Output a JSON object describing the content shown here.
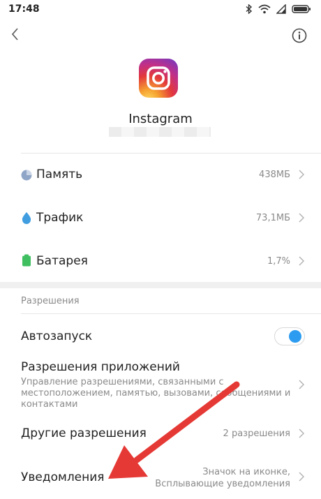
{
  "status_bar": {
    "time": "17:48"
  },
  "app": {
    "name": "Instagram"
  },
  "storage_rows": [
    {
      "label": "Память",
      "value": "438МБ",
      "icon": "pie-chart-icon"
    },
    {
      "label": "Трафик",
      "value": "73,1МБ",
      "icon": "drop-icon"
    },
    {
      "label": "Батарея",
      "value": "1,7%",
      "icon": "battery-icon"
    }
  ],
  "permissions": {
    "section_title": "Разрешения",
    "autostart": {
      "label": "Автозапуск",
      "enabled": true
    },
    "app_permissions": {
      "label": "Разрешения приложений",
      "desc_lines": [
        "Управление разрешениями, связанными с",
        "местоположением, памятью, вызовами, сообщениями и",
        "контактами"
      ]
    },
    "other": {
      "label": "Другие разрешения",
      "value": "2 разрешения"
    },
    "notifications": {
      "label": "Уведомления",
      "value_lines": [
        "Значок на иконке,",
        "Всплывающие уведомления"
      ]
    }
  },
  "colors": {
    "accent": "#2d9cf0",
    "annotation_arrow": "#e53935",
    "storage_icon": "#8fa5c7",
    "traffic_icon": "#3f9de0",
    "battery_icon": "#3fbf5f"
  }
}
